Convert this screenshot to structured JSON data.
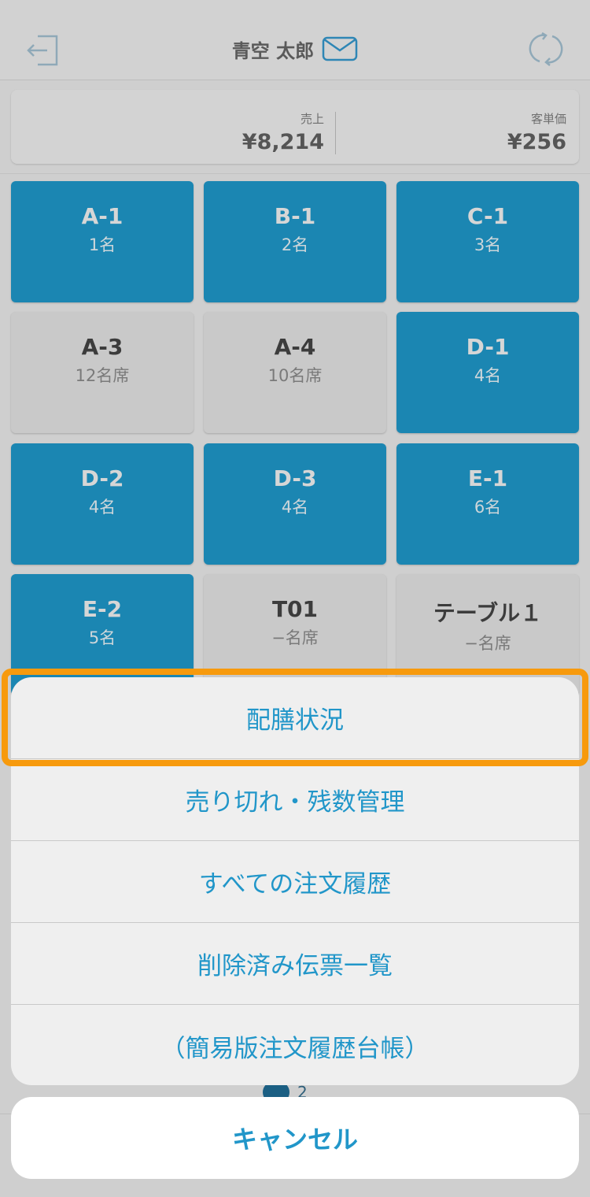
{
  "header": {
    "user_name": "青空 太郎",
    "logout_icon": "logout-icon",
    "mail_icon": "mail-icon",
    "refresh_icon": "refresh-icon"
  },
  "summary": {
    "sales_label": "売上",
    "sales_value": "¥8,214",
    "avg_label": "客単価",
    "avg_value": "¥256"
  },
  "tables": [
    {
      "name": "A-1",
      "capacity": "1名",
      "status": "occupied"
    },
    {
      "name": "B-1",
      "capacity": "2名",
      "status": "occupied"
    },
    {
      "name": "C-1",
      "capacity": "3名",
      "status": "occupied"
    },
    {
      "name": "A-3",
      "capacity": "12名席",
      "status": "free"
    },
    {
      "name": "A-4",
      "capacity": "10名席",
      "status": "free"
    },
    {
      "name": "D-1",
      "capacity": "4名",
      "status": "occupied"
    },
    {
      "name": "D-2",
      "capacity": "4名",
      "status": "occupied"
    },
    {
      "name": "D-3",
      "capacity": "4名",
      "status": "occupied"
    },
    {
      "name": "E-1",
      "capacity": "6名",
      "status": "occupied"
    },
    {
      "name": "E-2",
      "capacity": "5名",
      "status": "occupied"
    },
    {
      "name": "T01",
      "capacity": "−名席",
      "status": "free"
    },
    {
      "name": "テーブル１",
      "capacity": "−名席",
      "status": "free"
    }
  ],
  "pager": {
    "page_2": "2"
  },
  "action_sheet": {
    "items": [
      {
        "label": "配膳状況"
      },
      {
        "label": "売り切れ・残数管理"
      },
      {
        "label": "すべての注文履歴"
      },
      {
        "label": "削除済み伝票一覧"
      },
      {
        "label": "（簡易版注文履歴台帳）"
      }
    ],
    "cancel_label": "キャンセル",
    "highlighted_item": "配膳状況"
  },
  "colors": {
    "accent": "#2196c9",
    "occupied_tile": "#1b86b2",
    "free_tile": "#c9c9c9",
    "highlight": "#f79a0d"
  }
}
